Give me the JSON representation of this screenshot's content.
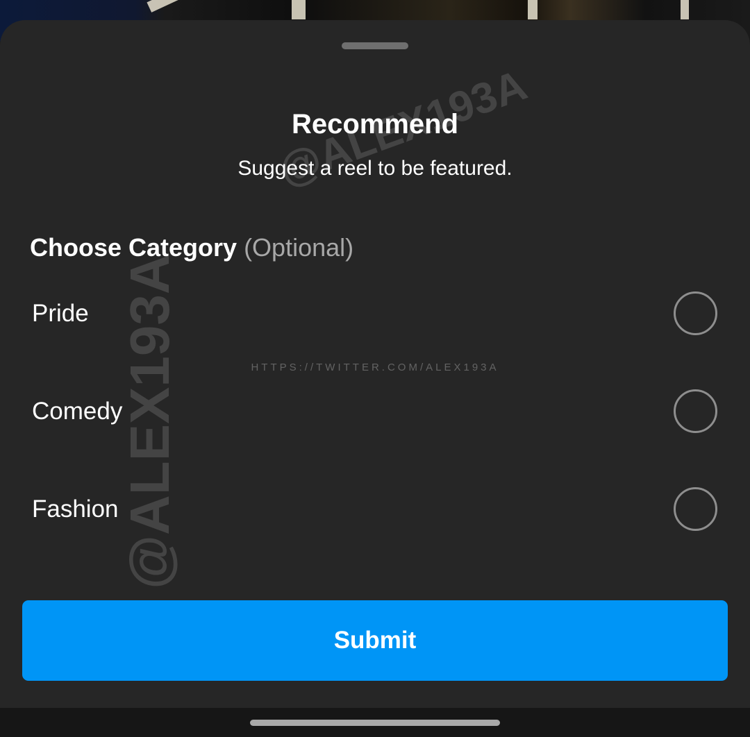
{
  "sheet": {
    "title": "Recommend",
    "subtitle": "Suggest a reel to be featured."
  },
  "category": {
    "heading": "Choose Category",
    "optional_tag": "(Optional)",
    "options": [
      {
        "label": "Pride",
        "selected": false
      },
      {
        "label": "Comedy",
        "selected": false
      },
      {
        "label": "Fashion",
        "selected": false
      }
    ]
  },
  "submit_label": "Submit",
  "watermark": {
    "handle": "@ALEX193A",
    "url": "HTTPS://TWITTER.COM/ALEX193A"
  },
  "colors": {
    "sheet_background": "#262626",
    "primary_button": "#0095f6",
    "radio_border": "#8e8e8e",
    "muted_text": "#a8a8a8"
  }
}
